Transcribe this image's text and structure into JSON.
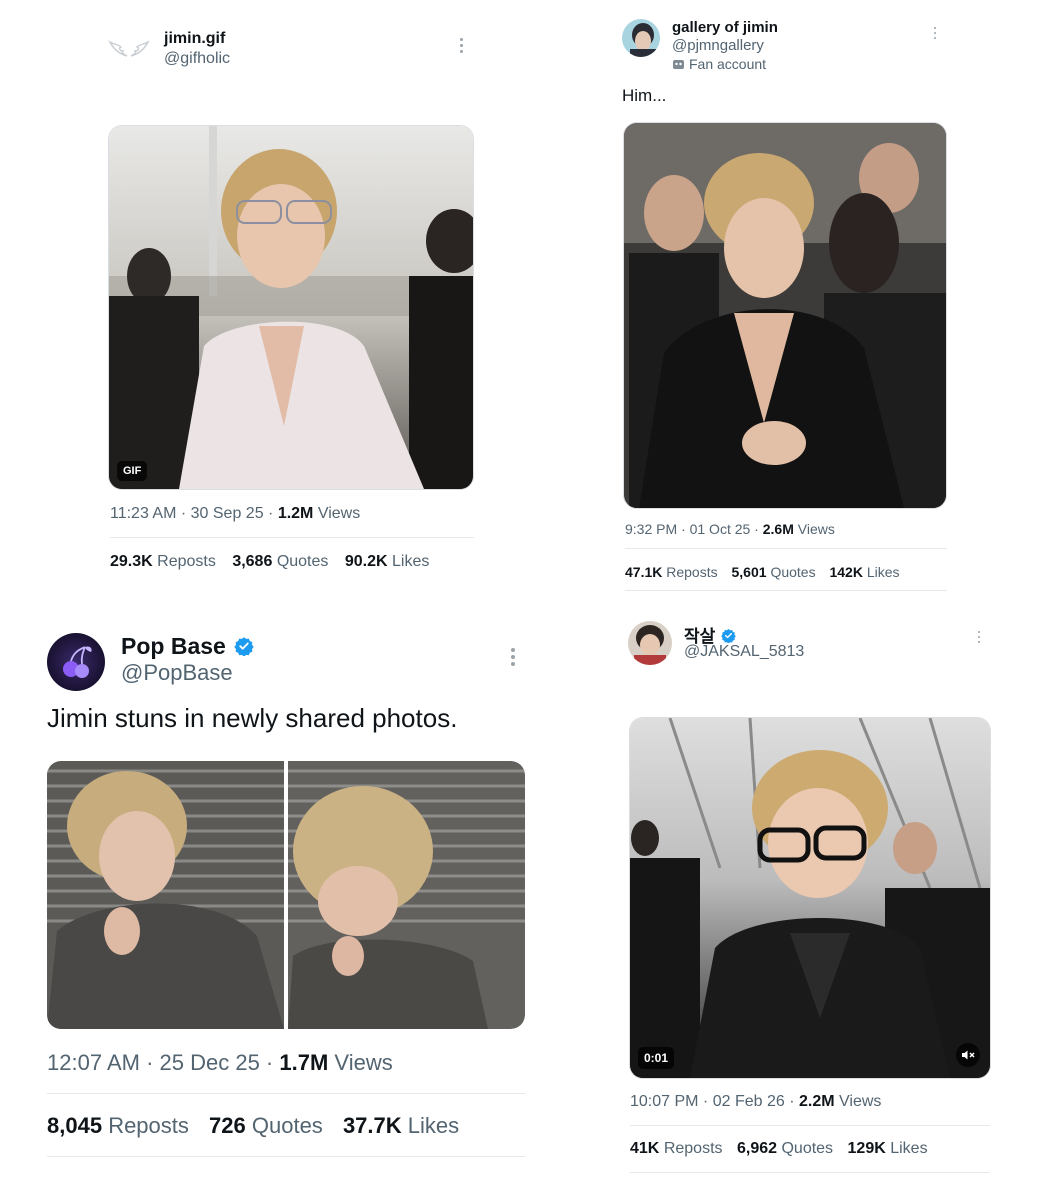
{
  "tweets": [
    {
      "name": "jimin.gif",
      "handle": "@gifholic",
      "media_badge": "GIF",
      "time": "11:23 AM",
      "date": "30 Sep 25",
      "views_count": "1.2M",
      "views_label": "Views",
      "reposts_count": "29.3K",
      "reposts_label": "Reposts",
      "quotes_count": "3,686",
      "quotes_label": "Quotes",
      "likes_count": "90.2K",
      "likes_label": "Likes"
    },
    {
      "name": "gallery of jimin",
      "handle": "@pjmngallery",
      "label": "Fan account",
      "text": "Him...",
      "time": "9:32 PM",
      "date": "01 Oct 25",
      "views_count": "2.6M",
      "views_label": "Views",
      "reposts_count": "47.1K",
      "reposts_label": "Reposts",
      "quotes_count": "5,601",
      "quotes_label": "Quotes",
      "likes_count": "142K",
      "likes_label": "Likes"
    },
    {
      "name": "Pop Base",
      "handle": "@PopBase",
      "text": "Jimin stuns in newly shared photos.",
      "time": "12:07 AM",
      "date": "25 Dec 25",
      "views_count": "1.7M",
      "views_label": "Views",
      "reposts_count": "8,045",
      "reposts_label": "Reposts",
      "quotes_count": "726",
      "quotes_label": "Quotes",
      "likes_count": "37.7K",
      "likes_label": "Likes"
    },
    {
      "name": "작살",
      "handle": "@JAKSAL_5813",
      "video_time": "0:01",
      "time": "10:07 PM",
      "date": "02 Feb 26",
      "views_count": "2.2M",
      "views_label": "Views",
      "reposts_count": "41K",
      "reposts_label": "Reposts",
      "quotes_count": "6,962",
      "quotes_label": "Quotes",
      "likes_count": "129K",
      "likes_label": "Likes"
    }
  ],
  "colors": {
    "verified": "#1d9bf0",
    "text_primary": "#0f1419",
    "text_secondary": "#536471"
  },
  "icons": [
    "angel-wings-icon",
    "more-options-icon",
    "verified-badge-icon",
    "fan-account-icon",
    "mute-icon"
  ]
}
